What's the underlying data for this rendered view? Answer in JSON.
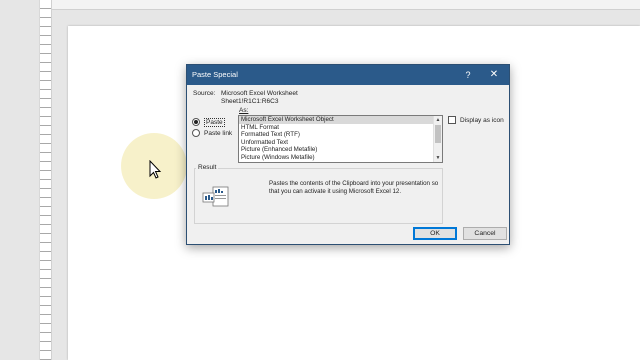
{
  "dialog": {
    "title": "Paste Special",
    "help_label": "?",
    "close_label": "✕",
    "source_label": "Source:",
    "source_name": "Microsoft Excel Worksheet",
    "source_range": "Sheet1!R1C1:R6C3",
    "as_label": "As:",
    "options": {
      "paste_label": "Paste",
      "paste_link_label": "Paste link",
      "selected": "paste"
    },
    "list_items": [
      "Microsoft Excel Worksheet Object",
      "HTML Format",
      "Formatted Text (RTF)",
      "Unformatted Text",
      "Picture (Enhanced Metafile)",
      "Picture (Windows Metafile)"
    ],
    "selected_item": "Microsoft Excel Worksheet Object",
    "display_as_icon_label": "Display as icon",
    "display_as_icon_checked": false,
    "result_label": "Result",
    "result_text": "Pastes the contents of the Clipboard into your presentation so that you can activate it using Microsoft Excel 12.",
    "ok_label": "OK",
    "cancel_label": "Cancel"
  },
  "colors": {
    "titlebar": "#2b5a8a",
    "dialog_bg": "#f0f0f0",
    "ok_focus": "#0078d7"
  },
  "icons": {
    "cursor": "mouse-pointer-icon",
    "result": "paste-object-icon"
  }
}
